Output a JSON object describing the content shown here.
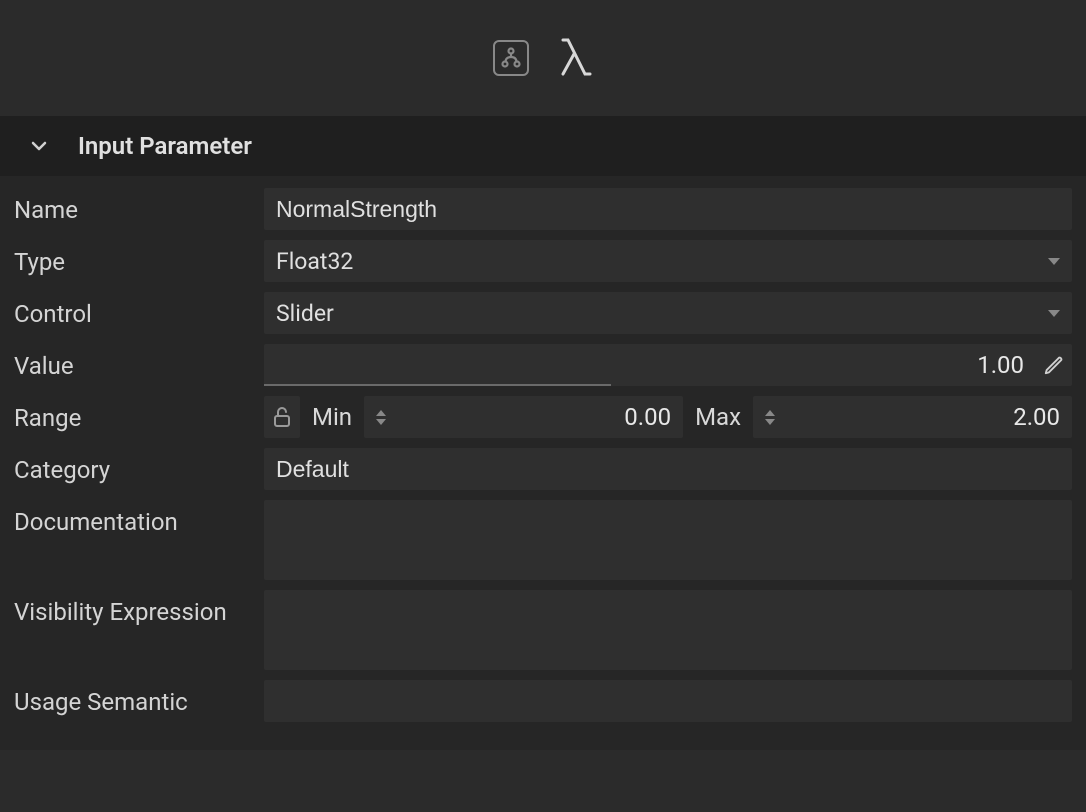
{
  "section": {
    "title": "Input Parameter"
  },
  "labels": {
    "name": "Name",
    "type": "Type",
    "control": "Control",
    "value": "Value",
    "range": "Range",
    "min": "Min",
    "max": "Max",
    "category": "Category",
    "documentation": "Documentation",
    "visibility": "Visibility Expression",
    "usage": "Usage Semantic"
  },
  "fields": {
    "name": "NormalStrength",
    "type": "Float32",
    "control": "Slider",
    "value": "1.00",
    "min": "0.00",
    "max": "2.00",
    "category": "Default",
    "documentation": "",
    "visibility": "",
    "usage": ""
  }
}
